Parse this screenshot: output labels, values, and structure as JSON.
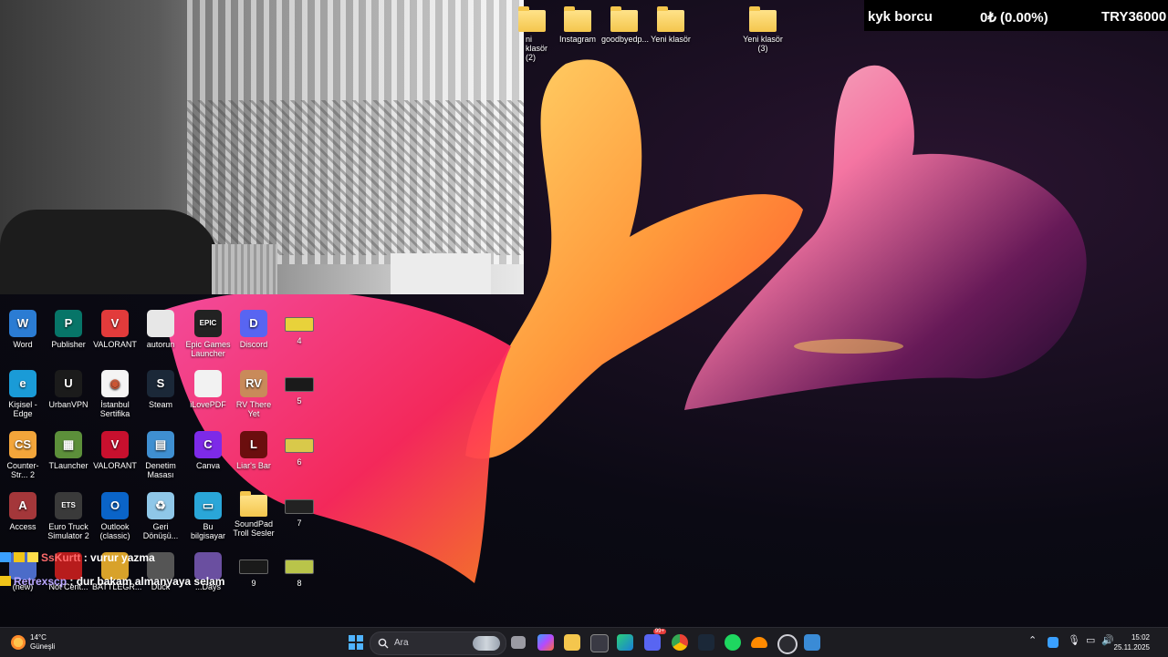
{
  "ticker": {
    "label": "kyk borcu",
    "change": "0₺ (0.00%)",
    "amount": "TRY36000"
  },
  "top_folders": [
    {
      "label": "ni klasör (2)"
    },
    {
      "label": "Instagram"
    },
    {
      "label": "goodbyedp..."
    },
    {
      "label": "Yeni klasör"
    },
    {
      "label": "Yeni klasör (3)"
    }
  ],
  "desktop_icons": [
    {
      "label": "Word",
      "icon": "word-icon",
      "color": "#2b7cd3",
      "glyph": "W"
    },
    {
      "label": "Publisher",
      "icon": "publisher-icon",
      "color": "#077568",
      "glyph": "P"
    },
    {
      "label": "VALORANT",
      "icon": "valorant-icon",
      "color": "#e23b3b",
      "glyph": "V"
    },
    {
      "label": "autorun",
      "icon": "file-icon",
      "color": "#e7e7e7",
      "glyph": ""
    },
    {
      "label": "Epic Games Launcher",
      "icon": "epic-games-icon",
      "color": "#222222",
      "glyph": "EPIC"
    },
    {
      "label": "Discord",
      "icon": "discord-icon",
      "color": "#5865f2",
      "glyph": "D"
    },
    {
      "label": "4",
      "icon": "image-thumb-icon",
      "color": "#e8d23a",
      "glyph": ""
    },
    {
      "label": "Kişisel - Edge",
      "icon": "edge-icon",
      "color": "#1a9bd7",
      "glyph": "e"
    },
    {
      "label": "UrbanVPN",
      "icon": "urbanvpn-icon",
      "color": "#1b1b1b",
      "glyph": "U"
    },
    {
      "label": "İstanbul Sertifika",
      "icon": "chrome-icon",
      "color": "#f4f4f4",
      "glyph": "◉"
    },
    {
      "label": "Steam",
      "icon": "steam-icon",
      "color": "#1b2838",
      "glyph": "S"
    },
    {
      "label": "iLovePDF",
      "icon": "file-icon",
      "color": "#f2f2f2",
      "glyph": ""
    },
    {
      "label": "RV There Yet",
      "icon": "game-icon",
      "color": "#c98a5a",
      "glyph": "RV"
    },
    {
      "label": "5",
      "icon": "image-thumb-icon",
      "color": "#1a1a1a",
      "glyph": ""
    },
    {
      "label": "Counter-Str... 2",
      "icon": "cs2-icon",
      "color": "#f3a53a",
      "glyph": "CS"
    },
    {
      "label": "TLauncher",
      "icon": "minecraft-icon",
      "color": "#5c8f3a",
      "glyph": "▦"
    },
    {
      "label": "VALORANT",
      "icon": "valorant-icon",
      "color": "#c8102e",
      "glyph": "V"
    },
    {
      "label": "Denetim Masası",
      "icon": "control-panel-icon",
      "color": "#3f8fd1",
      "glyph": "▤"
    },
    {
      "label": "Canva",
      "icon": "canva-icon",
      "color": "#7d2ae8",
      "glyph": "C"
    },
    {
      "label": "Liar's Bar",
      "icon": "game-icon",
      "color": "#6b0e0e",
      "glyph": "L"
    },
    {
      "label": "6",
      "icon": "image-thumb-icon",
      "color": "#d9c94a",
      "glyph": ""
    },
    {
      "label": "Access",
      "icon": "access-icon",
      "color": "#a4373a",
      "glyph": "A"
    },
    {
      "label": "Euro Truck Simulator 2",
      "icon": "truck-icon",
      "color": "#3a3a3a",
      "glyph": "ETS"
    },
    {
      "label": "Outlook (classic)",
      "icon": "outlook-icon",
      "color": "#0a64c8",
      "glyph": "O"
    },
    {
      "label": "Geri Dönüşü...",
      "icon": "recycle-bin-icon",
      "color": "#8fc7e8",
      "glyph": "♻"
    },
    {
      "label": "Bu bilgisayar",
      "icon": "computer-icon",
      "color": "#2aa6d8",
      "glyph": "▭"
    },
    {
      "label": "SoundPad Troll Sesler",
      "icon": "folder-icon",
      "color": "#f4c64d",
      "glyph": ""
    },
    {
      "label": "7",
      "icon": "image-thumb-icon",
      "color": "#222222",
      "glyph": ""
    },
    {
      "label": "(new)",
      "icon": "app-icon",
      "color": "#4b6cc9",
      "glyph": ""
    },
    {
      "label": "Not Cent...",
      "icon": "app-icon",
      "color": "#b71c1c",
      "glyph": ""
    },
    {
      "label": "BATTLEGR...",
      "icon": "pubg-icon",
      "color": "#d8a22a",
      "glyph": ""
    },
    {
      "label": "Duck",
      "icon": "game-icon",
      "color": "#555555",
      "glyph": ""
    },
    {
      "label": "...Days",
      "icon": "game-icon",
      "color": "#6a4fa0",
      "glyph": ""
    },
    {
      "label": "9",
      "icon": "image-thumb-icon",
      "color": "#1a1a1a",
      "glyph": ""
    },
    {
      "label": "8",
      "icon": "image-thumb-icon",
      "color": "#b9c44a",
      "glyph": ""
    }
  ],
  "chat": [
    {
      "user": "SsKurtt",
      "message": ": vurur yazma"
    },
    {
      "user": "Retrexscp",
      "message": ": dur bakam almanyaya selam"
    }
  ],
  "taskbar": {
    "temperature": "14°C",
    "weather": "Güneşli",
    "search_placeholder": "Ara",
    "apps": [
      "start-icon",
      "file-explorer-icon",
      "copilot-icon",
      "folder-icon",
      "store-icon",
      "edge-icon",
      "discord-icon",
      "chrome-icon",
      "steam-icon",
      "spotify-icon",
      "cloud-icon",
      "obs-icon",
      "app-icon"
    ],
    "notification_badges": {
      "discord": "99+"
    },
    "time": "15:02",
    "date": "25.11.2025"
  }
}
